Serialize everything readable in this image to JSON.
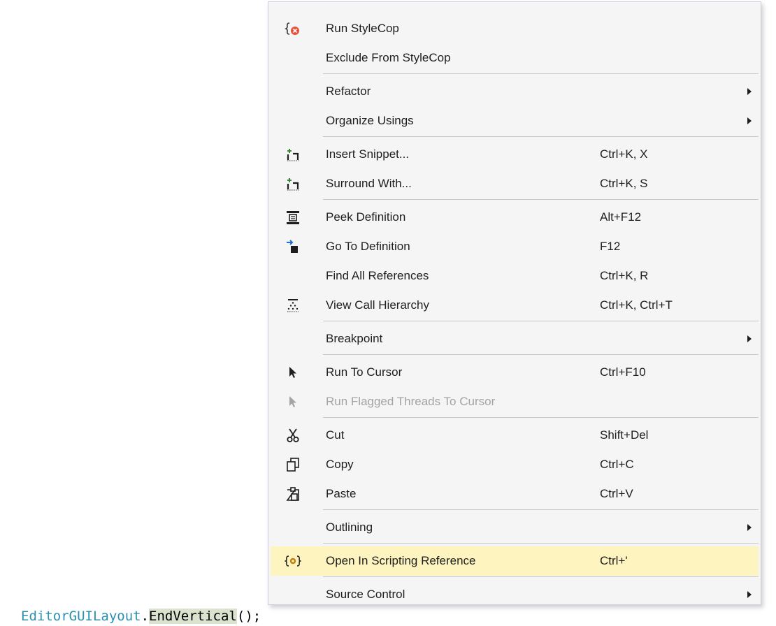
{
  "menu": {
    "items": [
      {
        "id": "run-stylecop",
        "icon": "stylecop-run-icon",
        "label": "Run StyleCop",
        "shortcut": ""
      },
      {
        "id": "exclude-from-stylecop",
        "icon": "",
        "label": "Exclude From StyleCop",
        "shortcut": ""
      },
      {
        "id": "refactor",
        "icon": "",
        "label": "Refactor",
        "shortcut": "",
        "submenu": true
      },
      {
        "id": "organize-usings",
        "icon": "",
        "label": "Organize Usings",
        "shortcut": "",
        "submenu": true
      },
      {
        "id": "insert-snippet",
        "icon": "snippet-icon",
        "label": "Insert Snippet...",
        "shortcut": "Ctrl+K, X"
      },
      {
        "id": "surround-with",
        "icon": "snippet-icon",
        "label": "Surround With...",
        "shortcut": "Ctrl+K, S"
      },
      {
        "id": "peek-definition",
        "icon": "peek-definition-icon",
        "label": "Peek Definition",
        "shortcut": "Alt+F12"
      },
      {
        "id": "go-to-definition",
        "icon": "go-to-definition-icon",
        "label": "Go To Definition",
        "shortcut": "F12"
      },
      {
        "id": "find-all-references",
        "icon": "",
        "label": "Find All References",
        "shortcut": "Ctrl+K, R"
      },
      {
        "id": "view-call-hierarchy",
        "icon": "call-hierarchy-icon",
        "label": "View Call Hierarchy",
        "shortcut": "Ctrl+K, Ctrl+T"
      },
      {
        "id": "breakpoint",
        "icon": "",
        "label": "Breakpoint",
        "shortcut": "",
        "submenu": true
      },
      {
        "id": "run-to-cursor",
        "icon": "cursor-arrow-icon",
        "label": "Run To Cursor",
        "shortcut": "Ctrl+F10"
      },
      {
        "id": "run-flagged-threads",
        "icon": "cursor-arrow-icon",
        "label": "Run Flagged Threads To Cursor",
        "shortcut": "",
        "disabled": true
      },
      {
        "id": "cut",
        "icon": "scissors-icon",
        "label": "Cut",
        "shortcut": "Shift+Del"
      },
      {
        "id": "copy",
        "icon": "copy-icon",
        "label": "Copy",
        "shortcut": "Ctrl+C"
      },
      {
        "id": "paste",
        "icon": "paste-icon",
        "label": "Paste",
        "shortcut": "Ctrl+V"
      },
      {
        "id": "outlining",
        "icon": "",
        "label": "Outlining",
        "shortcut": "",
        "submenu": true
      },
      {
        "id": "open-in-scripting-reference",
        "icon": "scripting-reference-icon",
        "label": "Open In Scripting Reference",
        "shortcut": "Ctrl+'",
        "highlighted": true
      },
      {
        "id": "source-control",
        "icon": "",
        "label": "Source Control",
        "shortcut": "",
        "submenu": true
      }
    ]
  },
  "code": {
    "class_name": "EditorGUILayout",
    "dot": ".",
    "method": "EndVertical",
    "suffix": "();"
  },
  "colors": {
    "menu_bg": "#f5f5f5",
    "highlight": "#fdf4bf",
    "separator": "#c9c9c9",
    "class_color": "#2b91af",
    "disabled_text": "#a2a4a5"
  }
}
